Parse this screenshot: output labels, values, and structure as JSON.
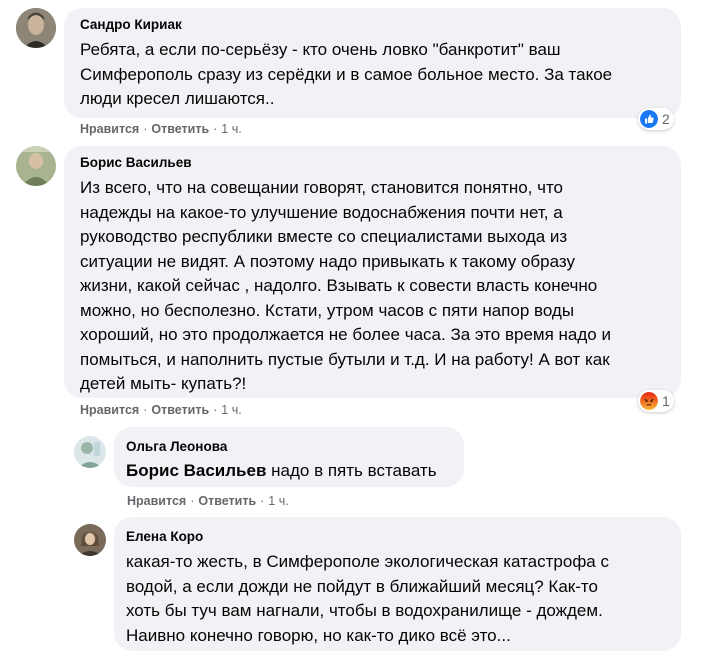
{
  "comments": [
    {
      "author": "Сандро Кириак",
      "text": "Ребята, а если по-серьёзу - кто очень ловко \"банкротит\" ваш\nСимферополь сразу из серёдки и в самое больное место. За такое\nлюди кресел лишаются..",
      "like_label": "Нравится",
      "reply_label": "Ответить",
      "time": "1 ч.",
      "reaction": "like-icon",
      "reaction_count": "2"
    },
    {
      "author": "Борис Васильев",
      "text": "Из всего, что на совещании говорят, становится понятно, что\nнадежды на какое-то улучшение водоснабжения почти нет, а\nруководство республики вместе со специалистами выхода из\nситуации не видят. А поэтому надо привыкать к такому образу\nжизни, какой сейчас , надолго. Взывать к совести власть конечно\nможно, но бесполезно. Кстати, утром часов с пяти напор воды\nхороший, но это продолжается не более часа. За это время надо и\nпомыться, и наполнить пустые бутыли и т.д. И на работу! А вот как\nдетей мыть- купать?!",
      "like_label": "Нравится",
      "reply_label": "Ответить",
      "time": "1 ч.",
      "reaction": "angry-icon",
      "reaction_count": "1"
    }
  ],
  "replies": [
    {
      "author": "Ольга Леонова",
      "mention": "Борис Васильев",
      "text": " надо в пять вставать",
      "like_label": "Нравится",
      "reply_label": "Ответить",
      "time": "1 ч."
    },
    {
      "author": "Елена Коро",
      "text": "какая-то жесть, в Симферополе экологическая катастрофа с\nводой, а если дожди не пойдут в ближайший месяц? Как-то\nхоть бы туч вам нагнали, чтобы в водохранилище - дождем.\nНаивно конечно говорю, но как-то дико всё это..."
    }
  ],
  "separator": "·",
  "colors": {
    "bubble": "#f0f2f5",
    "secondary_text": "#65676b",
    "like_blue": "#1877f2",
    "angry_orange": "#e9710f"
  }
}
